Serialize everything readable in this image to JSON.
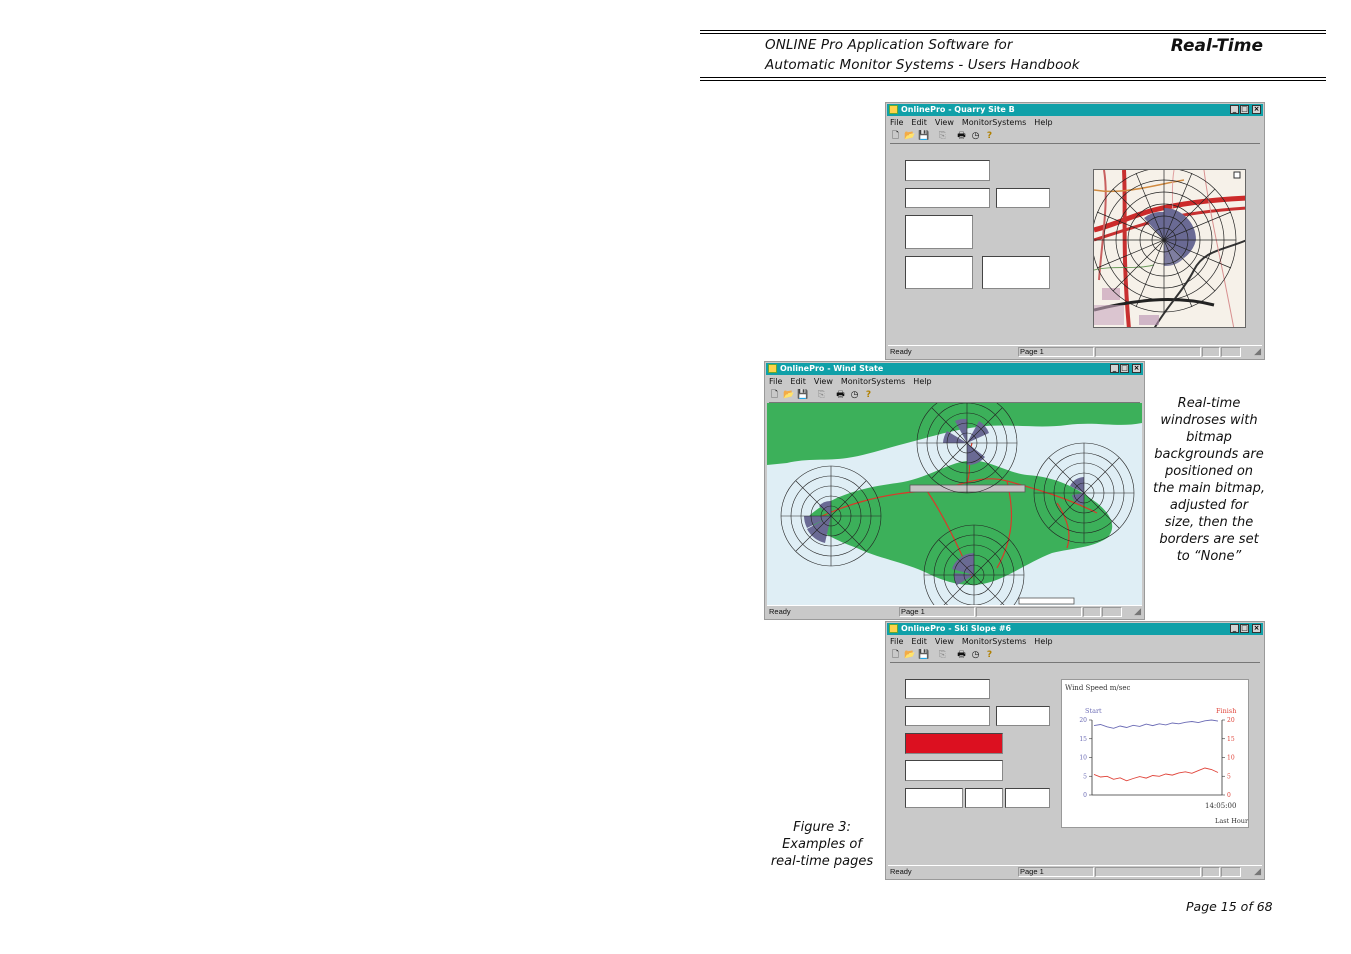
{
  "header": {
    "subtitle_line1": "ONLINE Pro Application Software for",
    "subtitle_line2": "Automatic Monitor Systems - Users Handbook",
    "section_title": "Real-Time"
  },
  "side_caption": [
    "Real-time",
    "windroses with",
    "bitmap",
    "backgrounds are",
    "positioned on",
    "the main bitmap,",
    "adjusted for",
    "size, then the",
    "borders are set",
    "to “None”"
  ],
  "figure_caption": [
    "Figure 3:",
    "Examples of",
    "real-time pages"
  ],
  "page_number": "Page 15 of 68",
  "menu": [
    "File",
    "Edit",
    "View",
    "MonitorSystems",
    "Help"
  ],
  "status": {
    "ready": "Ready",
    "page": "Page 1"
  },
  "windows": {
    "quarry": {
      "title": "OnlinePro - Quarry Site B"
    },
    "wind": {
      "title": "OnlinePro - Wind State"
    },
    "ski": {
      "title": "OnlinePro - Ski Slope #6"
    }
  },
  "ski_chart": {
    "title": "Wind Speed m/sec",
    "left_label": "Start",
    "right_label": "Finish",
    "time_label": "14:05:00",
    "period_label": "Last Hour",
    "left_color": "#6b6bb5",
    "right_color": "#e0443a"
  },
  "chart_data": {
    "type": "line",
    "title": "Wind Speed m/sec",
    "ylim": [
      0,
      20
    ],
    "yticks": [
      "20",
      "15",
      "10",
      "5",
      "0"
    ],
    "x_tick": "14:05:00",
    "xlabel": "Last Hour",
    "series": [
      {
        "name": "Start",
        "axis": "left",
        "color": "#6b6bb5",
        "values": [
          18.5,
          18.8,
          18.2,
          17.8,
          18.4,
          18.0,
          18.6,
          18.3,
          18.9,
          18.5,
          19.0,
          18.7,
          19.2,
          19.0,
          19.4,
          19.6,
          19.3,
          19.8,
          20.0,
          19.7
        ]
      },
      {
        "name": "Finish",
        "axis": "right",
        "color": "#e0443a",
        "values": [
          5.5,
          4.8,
          5.0,
          4.2,
          4.6,
          3.8,
          4.4,
          4.9,
          4.5,
          5.2,
          5.0,
          5.6,
          5.3,
          5.9,
          6.2,
          5.8,
          6.5,
          7.2,
          6.8,
          6.0
        ]
      }
    ]
  },
  "colors": {
    "titlebar": "#10a0a8",
    "window_bg": "#c9c9c9",
    "land": "#3cb05a",
    "sea": "#dfeef5",
    "rose_fill": "#6a6a94",
    "route": "#d83a2a"
  }
}
